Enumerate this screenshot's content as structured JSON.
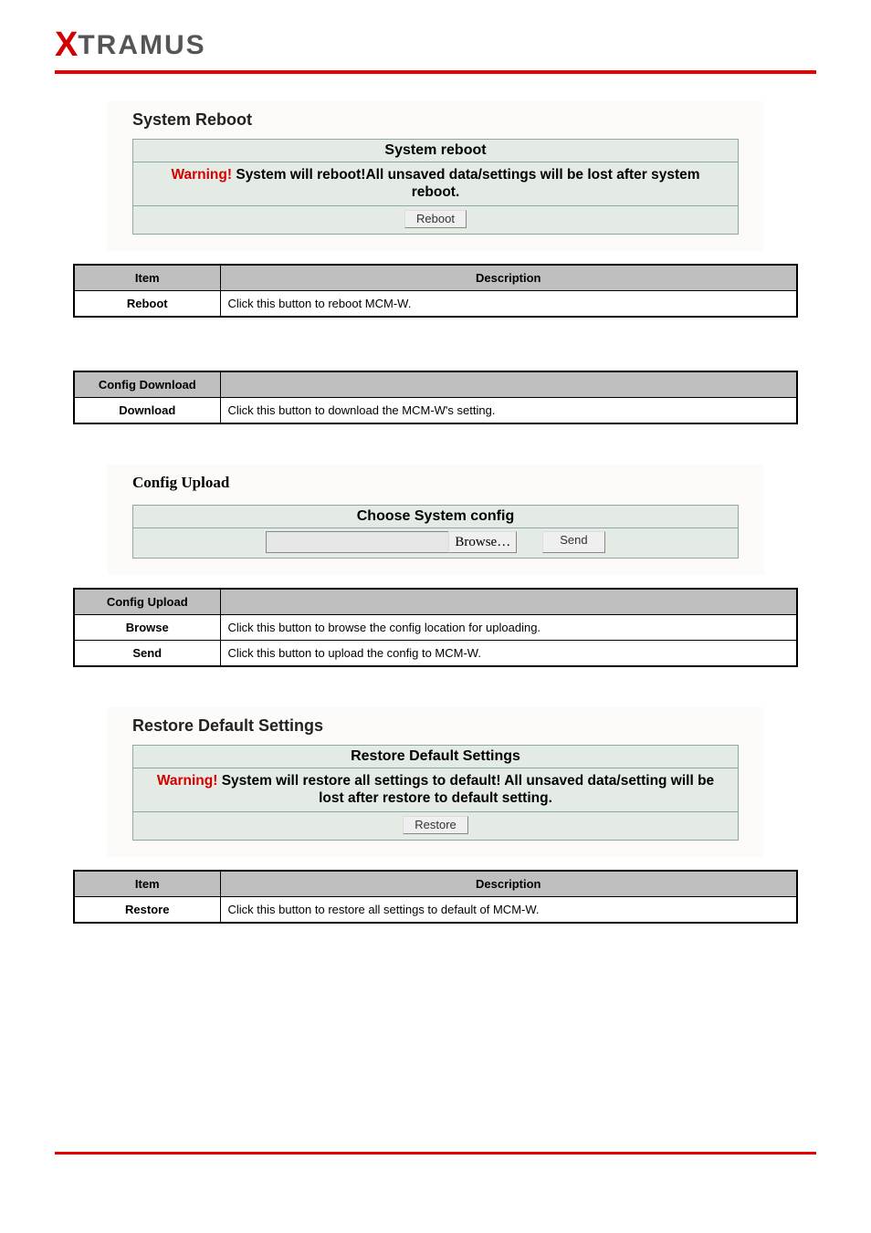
{
  "brand": {
    "x": "X",
    "rest": "TRAMUS"
  },
  "reboot_panel": {
    "section_title": "System Reboot",
    "header": "System reboot",
    "warning_label": "Warning!",
    "warning_text": " System will reboot!All unsaved data/settings will be lost after system reboot.",
    "button": "Reboot"
  },
  "reboot_table": {
    "head_item": "Item",
    "head_desc": "Description",
    "row_item": "Reboot",
    "row_desc": "Click this button to reboot MCM-W."
  },
  "download_table": {
    "head_item": "Config Download",
    "head_desc": "",
    "row_item": "Download",
    "row_desc": "Click this button to download the MCM-W's setting."
  },
  "upload_panel": {
    "section_title": "Config Upload",
    "header": "Choose System config",
    "browse": "Browse…",
    "send": "Send",
    "file_value": ""
  },
  "upload_table": {
    "head_item": "Config Upload",
    "head_desc": "",
    "rows": [
      {
        "item": "Browse",
        "desc": "Click this button to browse the config location for uploading."
      },
      {
        "item": "Send",
        "desc": "Click this button to upload the config to MCM-W."
      }
    ]
  },
  "restore_panel": {
    "section_title": "Restore Default Settings",
    "header": "Restore Default Settings",
    "warning_label": "Warning!",
    "warning_text": " System will restore all settings to default! All unsaved data/setting will be lost after restore to default setting.",
    "button": "Restore"
  },
  "restore_table": {
    "head_item": "Item",
    "head_desc": "Description",
    "row_item": "Restore",
    "row_desc": "Click this button to restore all settings to default of MCM-W."
  }
}
